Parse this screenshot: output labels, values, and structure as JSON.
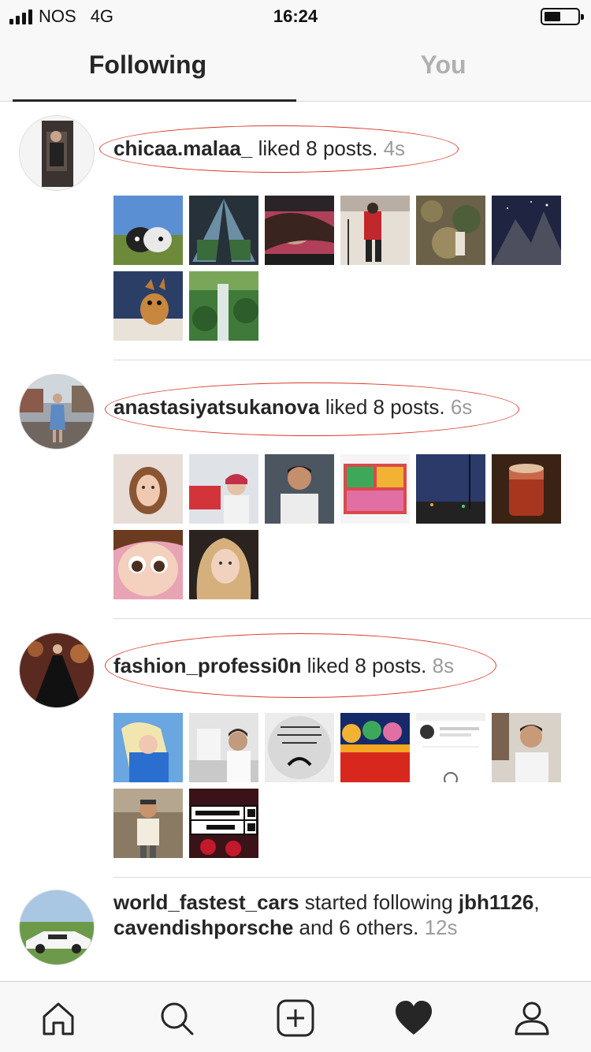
{
  "status_bar": {
    "carrier": "NOS",
    "network": "4G",
    "time": "16:24"
  },
  "tabs": {
    "following": "Following",
    "you": "You",
    "active": "Following"
  },
  "feed": [
    {
      "username": "chicaa.malaa_",
      "action": "liked 8 posts.",
      "time": "4s",
      "thumbnail_count": 8
    },
    {
      "username": "anastasiyatsukanova",
      "action": "liked 8 posts.",
      "time": "6s",
      "thumbnail_count": 8
    },
    {
      "username": "fashion_professi0n",
      "action": "liked 8 posts.",
      "time": "8s",
      "thumbnail_count": 8
    },
    {
      "username": "world_fastest_cars",
      "action": "started following",
      "targets": [
        "jbh1126",
        "cavendishporsche"
      ],
      "connector": ",",
      "and_text": "and 6",
      "others_text": "others.",
      "time": "12s"
    }
  ],
  "colors": {
    "accent_annotation": "#d93a2b",
    "text_primary": "#262626",
    "text_secondary": "#9b9b9b",
    "tab_inactive": "#b0b0b0"
  },
  "bottom_nav": [
    "home-icon",
    "search-icon",
    "new-post-icon",
    "activity-heart-icon",
    "profile-icon"
  ]
}
